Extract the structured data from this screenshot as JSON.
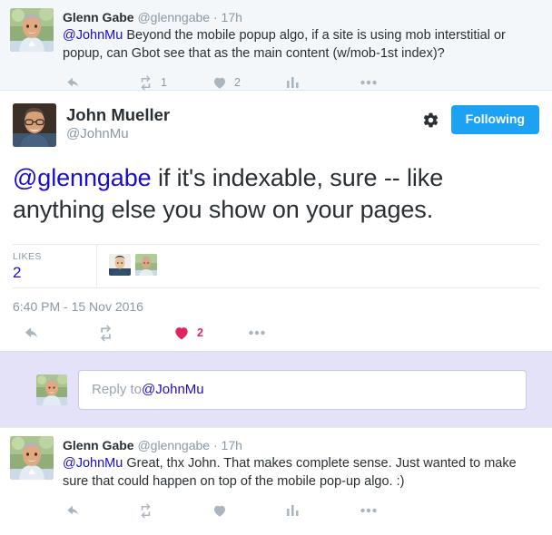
{
  "top_tweet": {
    "fullname": "Glenn Gabe",
    "handle": "@glenngabe",
    "separator": "·",
    "timestamp": "17h",
    "text_mention": "@JohnMu",
    "text_body": " Beyond the mobile popup algo, if a site is using mob interstitial or popup, can Gbot see that as the main content (w/mob-1st index)?",
    "actions": {
      "reply_count": "",
      "retweet_count": "1",
      "like_count": "2",
      "analytics_label": "",
      "more_label": ""
    }
  },
  "main_tweet": {
    "fullname": "John Mueller",
    "handle": "@JohnMu",
    "follow_button": "Following",
    "text_mention": "@glenngabe",
    "text_body": " if it's indexable, sure -- like anything else you show on your pages.",
    "likes_label": "LIKES",
    "likes_count": "2",
    "timestamp": "6:40 PM - 15 Nov 2016",
    "actions": {
      "reply_count": "",
      "retweet_count": "",
      "like_count": "2"
    }
  },
  "composer": {
    "placeholder_prefix": "Reply to ",
    "placeholder_handle": "@JohnMu"
  },
  "bottom_tweet": {
    "fullname": "Glenn Gabe",
    "handle": "@glenngabe",
    "separator": "·",
    "timestamp": "17h",
    "text_mention": "@JohnMu",
    "text_body": " Great, thx John. That makes complete sense. Just wanted to make sure that could happen on top of the mobile pop-up algo. :)",
    "actions": {
      "reply_count": "",
      "retweet_count": "",
      "like_count": ""
    }
  },
  "colors": {
    "twitter_blue": "#1da1f2",
    "like_red": "#e0245e",
    "link_blue": "#1a0dcc",
    "muted_gray": "#8899a6",
    "top_bg": "#f4f7f9",
    "composer_bg": "#e3e2f8"
  }
}
